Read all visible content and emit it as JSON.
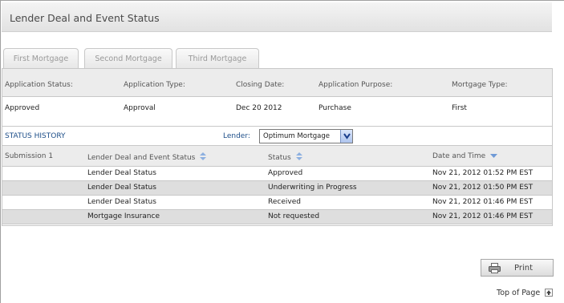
{
  "header": {
    "title": "Lender Deal and Event Status"
  },
  "tabs": [
    {
      "label": "First Mortgage"
    },
    {
      "label": "Second Mortgage"
    },
    {
      "label": "Third Mortgage"
    }
  ],
  "application": {
    "headers": {
      "status": "Application Status:",
      "type": "Application Type:",
      "closing": "Closing Date:",
      "purpose": "Application Purpose:",
      "mortgage_type": "Mortgage Type:"
    },
    "values": {
      "status": "Approved",
      "type": "Approval",
      "closing": "Dec 20 2012",
      "purpose": "Purchase",
      "mortgage_type": "First"
    }
  },
  "history": {
    "title": "STATUS HISTORY",
    "lender_label": "Lender:",
    "lender_value": "Optimum Mortgage",
    "columns": {
      "submission": "Submission 1",
      "event": "Lender Deal and Event Status",
      "status": "Status",
      "datetime": "Date and Time"
    },
    "rows": [
      {
        "event": "Lender Deal Status",
        "status": "Approved",
        "datetime": "Nov 21, 2012 01:52 PM EST"
      },
      {
        "event": "Lender Deal Status",
        "status": "Underwriting in Progress",
        "datetime": "Nov 21, 2012 01:50 PM EST"
      },
      {
        "event": "Lender Deal Status",
        "status": "Received",
        "datetime": "Nov 21, 2012 01:46 PM EST"
      },
      {
        "event": "Mortgage Insurance",
        "status": "Not requested",
        "datetime": "Nov 21, 2012 01:46 PM EST"
      }
    ]
  },
  "actions": {
    "print_label": "Print",
    "top_of_page": "Top of Page"
  },
  "icons": {
    "print": "printer-icon",
    "top": "arrow-up-icon",
    "sort": "sort-icon",
    "sort_desc": "sort-desc-icon",
    "dropdown": "chevron-down-icon"
  }
}
